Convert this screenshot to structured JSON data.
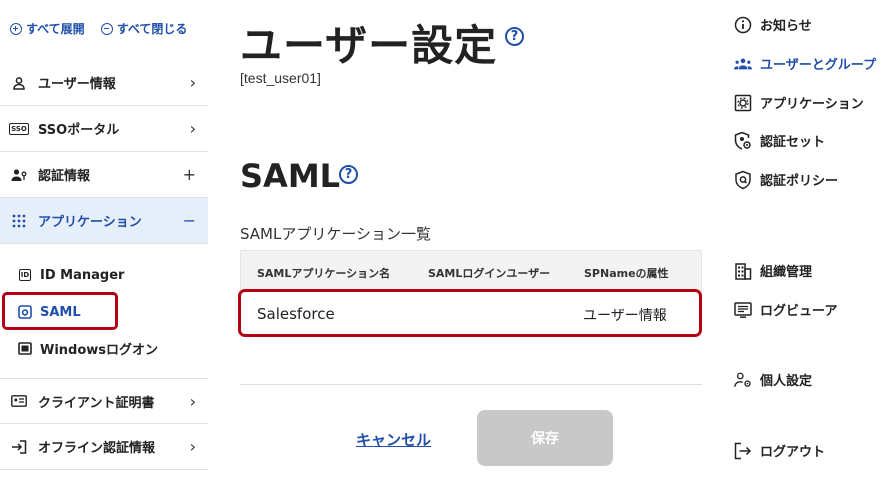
{
  "sidebar": {
    "expand_all": "すべて展開",
    "collapse_all": "すべて閉じる",
    "items": [
      {
        "label": "ユーザー情報",
        "toggle": "›"
      },
      {
        "label": "SSOポータル",
        "toggle": "›"
      },
      {
        "label": "認証情報",
        "toggle": "+"
      },
      {
        "label": "アプリケーション",
        "toggle": "−"
      },
      {
        "label": "クライアント証明書",
        "toggle": "›"
      },
      {
        "label": "オフライン認証情報",
        "toggle": "›"
      }
    ],
    "sub_items": [
      {
        "label": "ID Manager"
      },
      {
        "label": "SAML"
      },
      {
        "label": "Windowsログオン"
      }
    ],
    "icons": {
      "sso": "SSO",
      "id": "ID"
    }
  },
  "main": {
    "title": "ユーザー設定",
    "help_glyph": "?",
    "username": "[test_user01]",
    "section_title": "SAML",
    "list_label": "SAMLアプリケーション一覧",
    "table": {
      "headers": [
        "SAMLアプリケーション名",
        "SAMLログインユーザー",
        "SPNameの属性"
      ],
      "rows": [
        [
          "Salesforce",
          "",
          "ユーザー情報"
        ]
      ]
    },
    "cancel": "キャンセル",
    "save": "保存"
  },
  "right_nav": {
    "items": [
      {
        "label": "お知らせ",
        "icon": "info-icon"
      },
      {
        "label": "ユーザーとグループ",
        "icon": "users-icon"
      },
      {
        "label": "アプリケーション",
        "icon": "app-gear-icon"
      },
      {
        "label": "認証セット",
        "icon": "shield-gear-icon"
      },
      {
        "label": "認証ポリシー",
        "icon": "shield-icon"
      },
      {
        "label": "組織管理",
        "icon": "building-icon"
      },
      {
        "label": "ログビューア",
        "icon": "log-viewer-icon"
      },
      {
        "label": "個人設定",
        "icon": "person-gear-icon"
      },
      {
        "label": "ログアウト",
        "icon": "logout-icon"
      }
    ]
  },
  "colors": {
    "accent": "#1f4fa8",
    "highlight": "#b40012",
    "active_bg": "#e6eef9",
    "disabled": "#c8c8c8"
  }
}
